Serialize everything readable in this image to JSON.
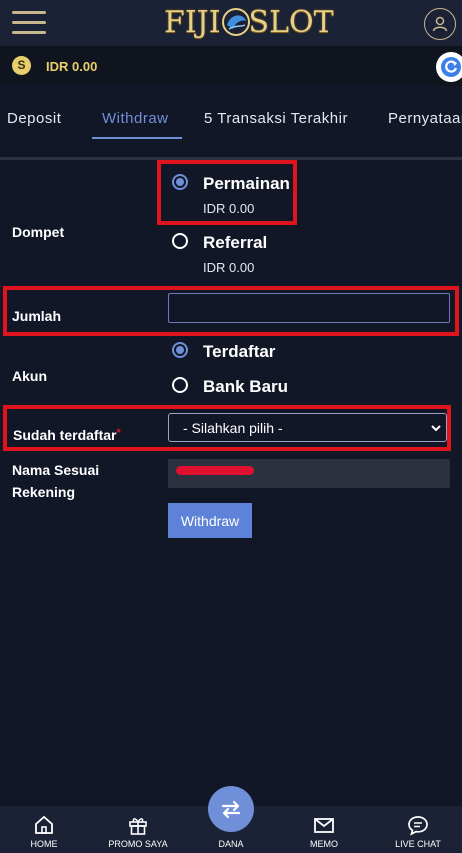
{
  "header": {
    "logo_left": "FIJI",
    "logo_right": "SLOT"
  },
  "balance": {
    "currency_icon": "S",
    "text": "IDR 0.00"
  },
  "tabs": [
    {
      "label": "Deposit"
    },
    {
      "label": "Withdraw"
    },
    {
      "label": "5 Transaksi Terakhir"
    },
    {
      "label": "Pernyataan"
    }
  ],
  "form": {
    "dompet_label": "Dompet",
    "wallets": [
      {
        "label": "Permainan",
        "amount": "IDR 0.00",
        "selected": true
      },
      {
        "label": "Referral",
        "amount": "IDR 0.00",
        "selected": false
      }
    ],
    "jumlah_label": "Jumlah",
    "jumlah_value": "",
    "akun_label": "Akun",
    "accounts": [
      {
        "label": "Terdaftar",
        "selected": true
      },
      {
        "label": "Bank Baru",
        "selected": false
      }
    ],
    "sudah_label": "Sudah terdaftar",
    "required_mark": "*",
    "select_value": "- Silahkan pilih -",
    "nama_label_1": "Nama Sesuai",
    "nama_label_2": "Rekening",
    "withdraw_button": "Withdraw"
  },
  "bottom_nav": [
    {
      "label": "HOME",
      "icon": "home-icon"
    },
    {
      "label": "PROMO SAYA",
      "icon": "gift-icon"
    },
    {
      "label": "DANA",
      "icon": "transfer-icon"
    },
    {
      "label": "MEMO",
      "icon": "mail-icon"
    },
    {
      "label": "LIVE CHAT",
      "icon": "chat-icon"
    }
  ],
  "colors": {
    "background": "#121728",
    "accent": "#6f8fd8",
    "highlight": "#e0141c",
    "gold": "#e8cf6d"
  }
}
